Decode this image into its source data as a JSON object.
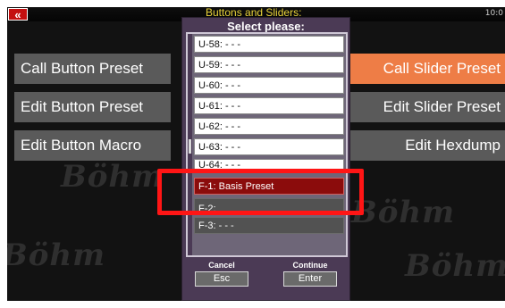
{
  "window": {
    "title": "Buttons and Sliders:",
    "time": "10:0",
    "back_glyph": "«",
    "back_icon": "double-chevron-left-icon"
  },
  "watermark": {
    "text": "Böhm"
  },
  "left_menu": [
    {
      "label": "Call Button Preset"
    },
    {
      "label": "Edit Button Preset"
    },
    {
      "label": "Edit Button Macro"
    }
  ],
  "right_menu": [
    {
      "label": "Call Slider Preset",
      "active": true
    },
    {
      "label": "Edit Slider Preset"
    },
    {
      "label": "Edit Hexdump"
    }
  ],
  "dialog": {
    "title": "Select please:",
    "items": [
      {
        "label": "U-58: - - -"
      },
      {
        "label": "U-59: - - -"
      },
      {
        "label": "U-60: - - -"
      },
      {
        "label": "U-61: - - -"
      },
      {
        "label": "U-62: - - -"
      },
      {
        "label": "U-63: - - -"
      },
      {
        "label": "U-64: - - -"
      },
      {
        "label": "F-1: Basis Preset",
        "selected": true
      },
      {
        "label": "F-2:"
      },
      {
        "label": "F-3: - - -"
      }
    ],
    "cancel": {
      "caption": "Cancel",
      "key": "Esc"
    },
    "continue": {
      "caption": "Continue",
      "key": "Enter"
    }
  },
  "colors": {
    "accent_orange": "#ee7d46",
    "selected_red": "#8b0c0c",
    "highlight_red": "#ff1515",
    "title_yellow": "#e8d23a"
  }
}
